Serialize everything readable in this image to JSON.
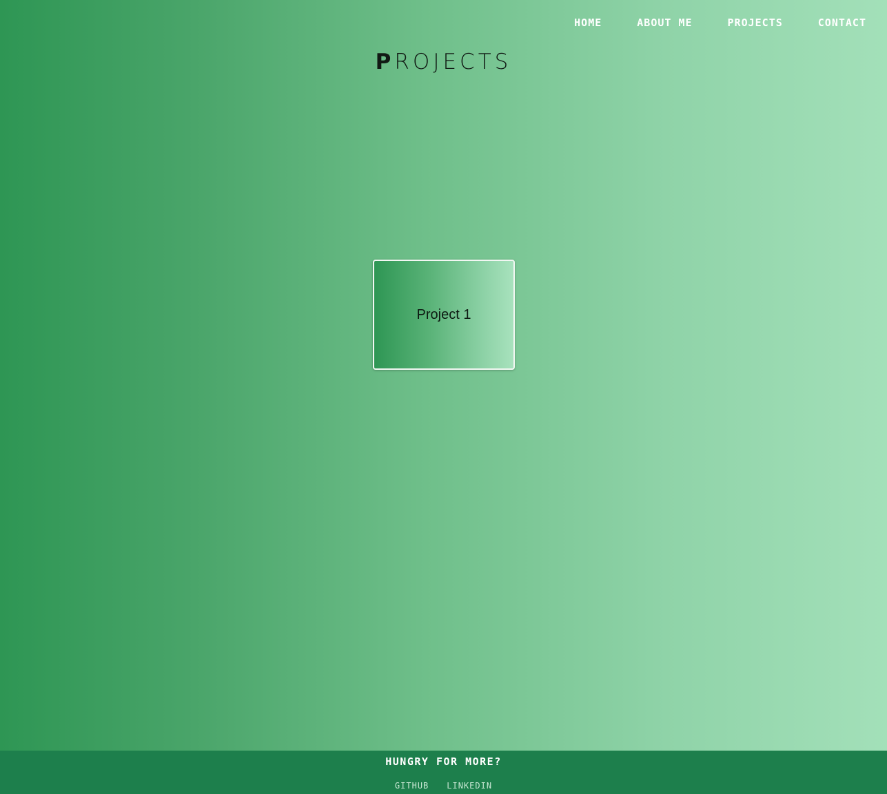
{
  "nav": {
    "items": [
      {
        "label": "HOME"
      },
      {
        "label": "ABOUT ME"
      },
      {
        "label": "PROJECTS"
      },
      {
        "label": "CONTACT"
      }
    ]
  },
  "page": {
    "title_first": "P",
    "title_rest": "ROJECTS"
  },
  "projects": [
    {
      "label": "Project 1"
    }
  ],
  "footer": {
    "heading": "HUNGRY FOR MORE?",
    "links": [
      {
        "label": "GITHUB"
      },
      {
        "label": "LINKEDIN"
      }
    ]
  },
  "colors": {
    "gradient_start": "#2e9654",
    "gradient_end": "#a3e0b9",
    "footer_bg": "#1d7f4c",
    "nav_text": "#ffffff"
  }
}
